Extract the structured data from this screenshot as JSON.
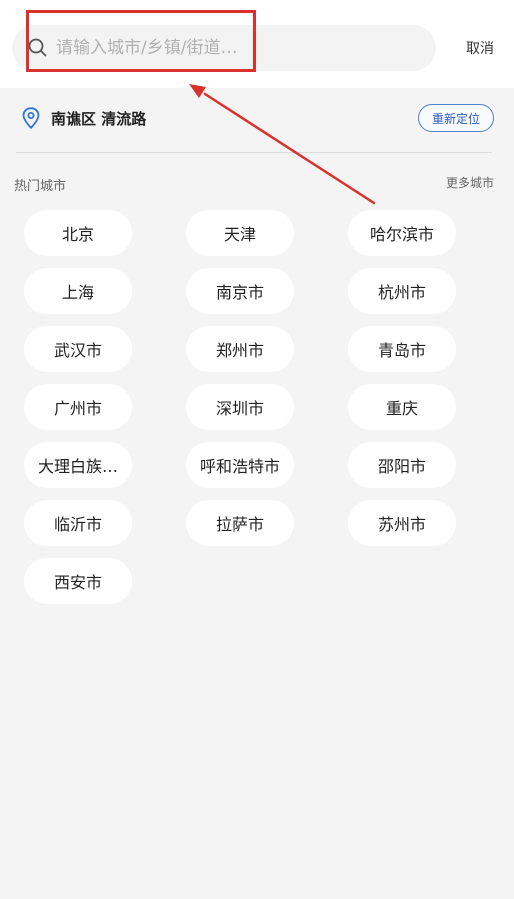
{
  "search": {
    "placeholder": "请输入城市/乡镇/街道…",
    "cancel_label": "取消"
  },
  "location": {
    "current": "南谯区 清流路",
    "relocate_label": "重新定位"
  },
  "hot_cities": {
    "title": "热门城市",
    "more_label": "更多城市",
    "items": [
      {
        "label": "北京"
      },
      {
        "label": "天津"
      },
      {
        "label": "哈尔滨市"
      },
      {
        "label": "上海"
      },
      {
        "label": "南京市"
      },
      {
        "label": "杭州市"
      },
      {
        "label": "武汉市"
      },
      {
        "label": "郑州市"
      },
      {
        "label": "青岛市"
      },
      {
        "label": "广州市"
      },
      {
        "label": "深圳市"
      },
      {
        "label": "重庆"
      },
      {
        "label": "大理白族…"
      },
      {
        "label": "呼和浩特市"
      },
      {
        "label": "邵阳市"
      },
      {
        "label": "临沂市"
      },
      {
        "label": "拉萨市"
      },
      {
        "label": "苏州市"
      },
      {
        "label": "西安市"
      }
    ]
  },
  "colors": {
    "annotation_red": "#d9312e",
    "accent_blue": "#2f5fbf",
    "page_background": "#f4f4f5"
  }
}
